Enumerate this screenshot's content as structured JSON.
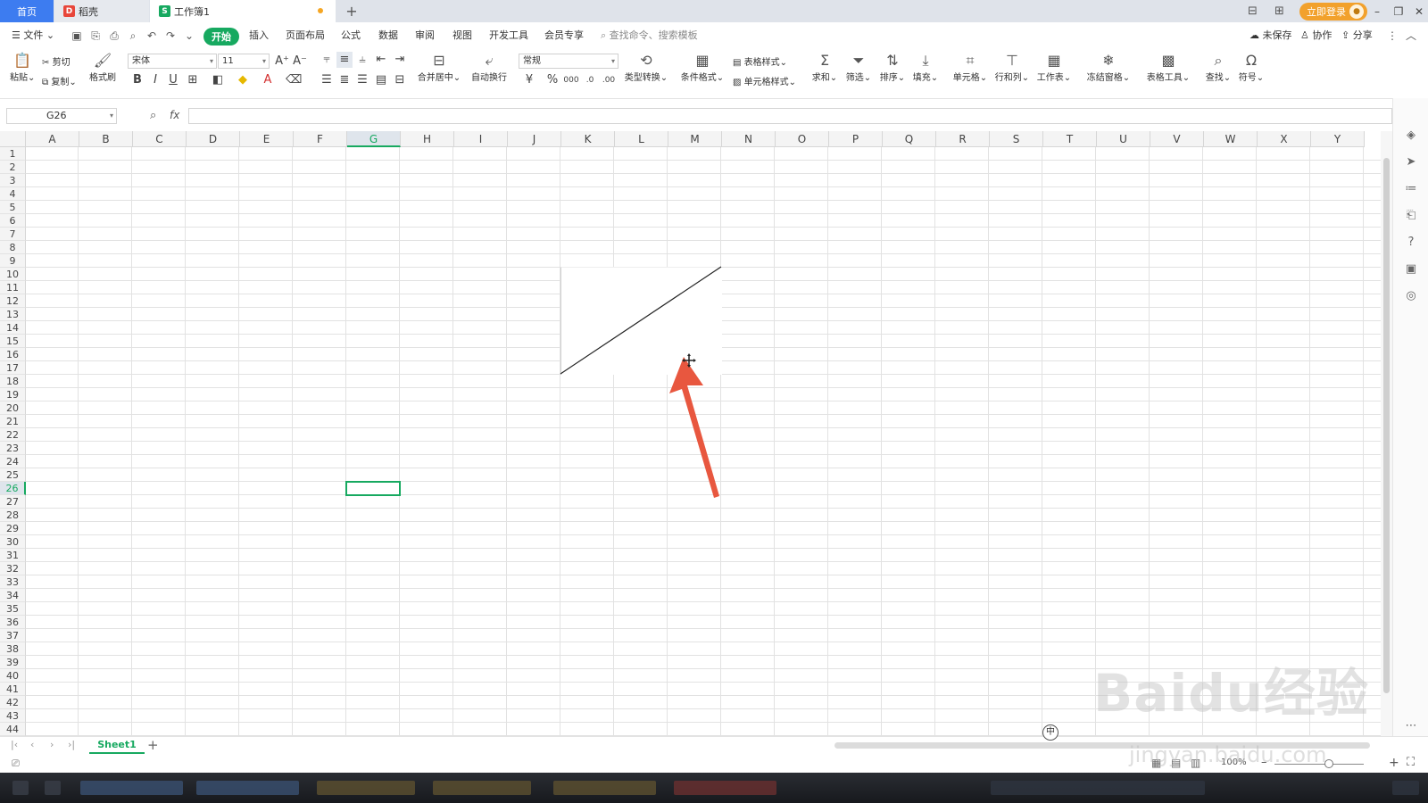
{
  "tabs": {
    "home": "首页",
    "docer": "稻壳",
    "workbook": "工作簿1"
  },
  "titlebar": {
    "login": "立即登录"
  },
  "menu": {
    "file": "文件",
    "items": [
      "开始",
      "插入",
      "页面布局",
      "公式",
      "数据",
      "审阅",
      "视图",
      "开发工具",
      "会员专享"
    ],
    "search_placeholder": "查找命令、搜索模板",
    "unsaved": "未保存",
    "collab": "协作",
    "share": "分享"
  },
  "ribbon": {
    "paste": "粘贴",
    "cut": "剪切",
    "copy": "复制",
    "format_painter": "格式刷",
    "font_name": "宋体",
    "font_size": "11",
    "merge_center": "合并居中",
    "wrap_text": "自动换行",
    "number_format": "常规",
    "type_convert": "类型转换",
    "cond_format": "条件格式",
    "table_style": "表格样式",
    "cell_style": "单元格样式",
    "sum": "求和",
    "filter": "筛选",
    "sort": "排序",
    "fill": "填充",
    "cell": "单元格",
    "row_col": "行和列",
    "worksheet": "工作表",
    "freeze": "冻结窗格",
    "table_tools": "表格工具",
    "find": "查找",
    "symbol": "符号"
  },
  "formula_bar": {
    "cell_ref": "G26",
    "fx": "fx",
    "value": ""
  },
  "columns": [
    "A",
    "B",
    "C",
    "D",
    "E",
    "F",
    "G",
    "H",
    "I",
    "J",
    "K",
    "L",
    "M",
    "N",
    "O",
    "P",
    "Q",
    "R",
    "S",
    "T",
    "U",
    "V",
    "W",
    "X",
    "Y"
  ],
  "rows": [
    "1",
    "2",
    "3",
    "4",
    "5",
    "6",
    "7",
    "8",
    "9",
    "10",
    "11",
    "12",
    "13",
    "14",
    "15",
    "16",
    "17",
    "18",
    "19",
    "20",
    "21",
    "22",
    "23",
    "24",
    "25",
    "26",
    "27",
    "28",
    "29",
    "30",
    "31",
    "32",
    "33",
    "34",
    "35",
    "36",
    "37",
    "38",
    "39",
    "40",
    "41",
    "42",
    "43",
    "44"
  ],
  "sheets": [
    "Sheet1"
  ],
  "status": {
    "zoom": "100%",
    "ime": "中"
  },
  "watermark": {
    "main": "Baidu经验",
    "url": "jingyan.baidu.com"
  },
  "colors": {
    "accent": "#17a960",
    "home_tab": "#3d7cf0",
    "login": "#f2a12c",
    "arrow": "#e8573f"
  }
}
